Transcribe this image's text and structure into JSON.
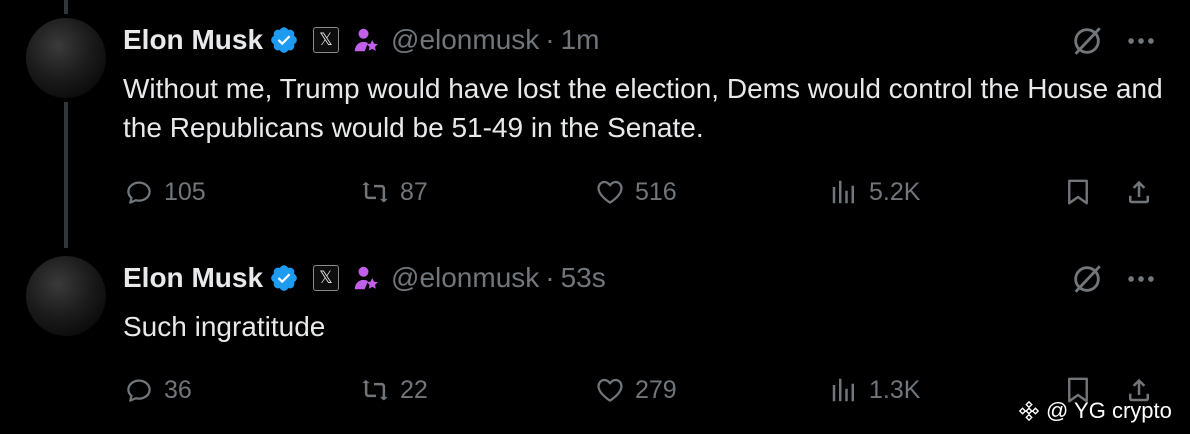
{
  "tweets": [
    {
      "author": {
        "name": "Elon Musk",
        "handle": "@elonmusk",
        "x_badge": "𝕏"
      },
      "separator": "·",
      "time": "1m",
      "text": "Without me, Trump would have lost the election, Dems would control the House and the Republicans would be 51-49 in the Senate.",
      "stats": {
        "replies": "105",
        "reposts": "87",
        "likes": "516",
        "views": "5.2K"
      }
    },
    {
      "author": {
        "name": "Elon Musk",
        "handle": "@elonmusk",
        "x_badge": "𝕏"
      },
      "separator": "·",
      "time": "53s",
      "text": "Such ingratitude",
      "stats": {
        "replies": "36",
        "reposts": "22",
        "likes": "279",
        "views": "1.3K"
      }
    }
  ],
  "icons": {
    "reply": "reply-icon",
    "repost": "repost-icon",
    "like": "like-icon",
    "views": "views-icon",
    "bookmark": "bookmark-icon",
    "share": "share-icon",
    "grok": "grok-icon",
    "more": "more-icon",
    "verified": "verified-badge-icon",
    "affiliate": "affiliate-icon"
  },
  "colors": {
    "background": "#000000",
    "text": "#e7e9ea",
    "muted": "#71767b",
    "verified_blue": "#1d9bf0",
    "affiliate_purple": "#c060e8"
  },
  "watermark": {
    "text": "@ YG crypto"
  }
}
